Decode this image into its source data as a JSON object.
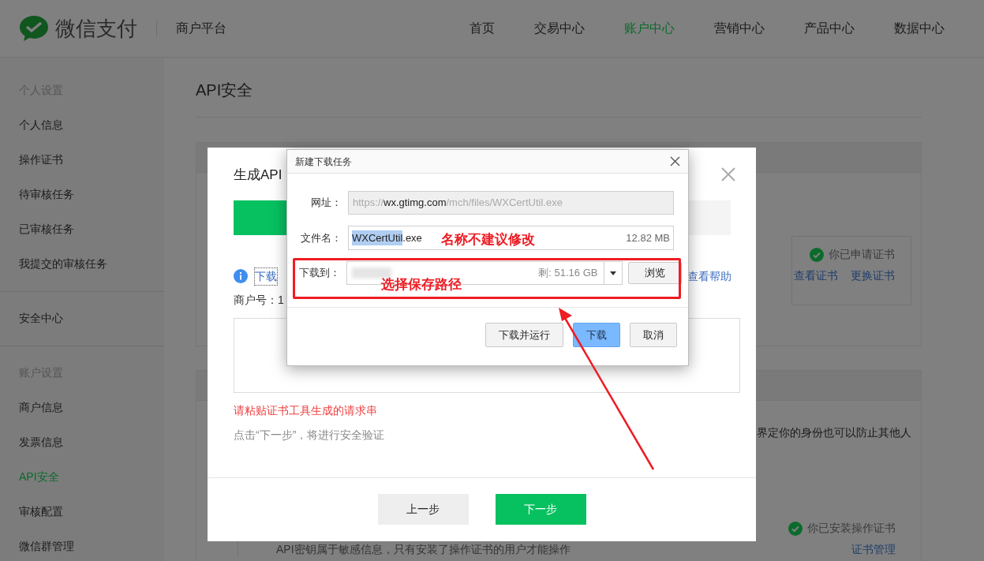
{
  "header": {
    "brand": "微信支付",
    "platform": "商户平台",
    "nav": [
      {
        "label": "首页",
        "selected": false
      },
      {
        "label": "交易中心",
        "selected": false
      },
      {
        "label": "账户中心",
        "selected": true
      },
      {
        "label": "营销中心",
        "selected": false
      },
      {
        "label": "产品中心",
        "selected": false
      },
      {
        "label": "数据中心",
        "selected": false
      }
    ]
  },
  "sidebar": {
    "groups": [
      {
        "title": "个人设置",
        "items": [
          {
            "label": "个人信息",
            "selected": false
          },
          {
            "label": "操作证书",
            "selected": false
          },
          {
            "label": "待审核任务",
            "selected": false
          },
          {
            "label": "已审核任务",
            "selected": false
          },
          {
            "label": "我提交的审核任务",
            "selected": false
          }
        ]
      },
      {
        "items": [
          {
            "label": "安全中心",
            "selected": false
          }
        ]
      },
      {
        "title": "账户设置",
        "items": [
          {
            "label": "商户信息",
            "selected": false
          },
          {
            "label": "发票信息",
            "selected": false
          },
          {
            "label": "API安全",
            "selected": true
          },
          {
            "label": "审核配置",
            "selected": false
          },
          {
            "label": "微信群管理",
            "selected": false
          }
        ]
      }
    ]
  },
  "page": {
    "title": "API安全",
    "cards": [
      {
        "status": "你已申请证书",
        "links": [
          "查看证书",
          "更换证书"
        ]
      },
      {
        "text": "界定你的身份也可以防止其他人",
        "status": "你已安装操作证书",
        "links": [
          "证书管理"
        ],
        "note": "API密钥属于敏感信息，只有安装了操作证书的用户才能操作"
      }
    ]
  },
  "modal": {
    "title": "生成API",
    "download_link": "下载",
    "help_link": "查看帮助",
    "merchant_label": "商户号：",
    "merchant_value": "1",
    "error": "请粘贴证书工具生成的请求串",
    "hint": "点击“下一步”，将进行安全验证",
    "buttons": [
      {
        "label": "上一步",
        "kind": "secondary"
      },
      {
        "label": "下一步",
        "kind": "primary"
      }
    ]
  },
  "download_dialog": {
    "title": "新建下载任务",
    "url": {
      "label": "网址：",
      "scheme": "https://",
      "host": "wx.gtimg.com",
      "path": "/mch/files/WXCertUtil.exe"
    },
    "filename": {
      "label": "文件名：",
      "selected_part": "WXCertUtil",
      "rest": ".exe",
      "size": "12.82 MB"
    },
    "save_to": {
      "label": "下载到：",
      "free": "剩: 51.16 GB",
      "browse": "浏览"
    },
    "buttons": [
      {
        "label": "下载并运行",
        "kind": "secondary"
      },
      {
        "label": "下载",
        "kind": "primary"
      },
      {
        "label": "取消",
        "kind": "secondary"
      }
    ]
  },
  "annotations": [
    {
      "text": "名称不建议修改"
    },
    {
      "text": "选择保存路径"
    }
  ]
}
